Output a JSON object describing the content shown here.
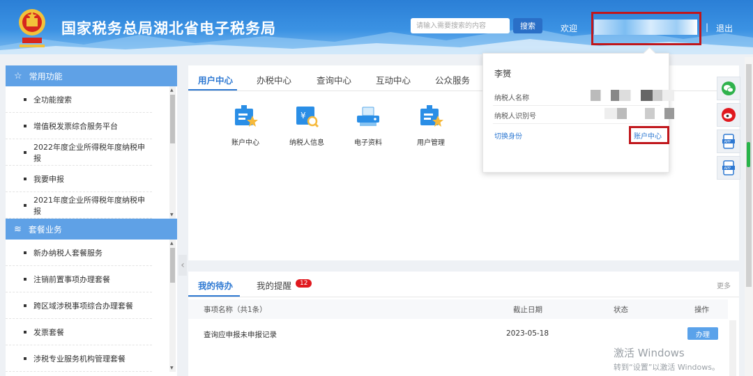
{
  "header": {
    "title": "国家税务总局湖北省电子税务局",
    "search_placeholder": "请输入需要搜索的内容",
    "search_button": "搜索",
    "welcome": "欢迎",
    "separator": "|",
    "logout": "退出"
  },
  "sidebar": {
    "sections": [
      {
        "title": "常用功能",
        "icon": "star-icon",
        "items": [
          "全功能搜索",
          "增值税发票综合服务平台",
          "2022年度企业所得税年度纳税申报",
          "我要申报",
          "2021年度企业所得税年度纳税申报"
        ]
      },
      {
        "title": "套餐业务",
        "icon": "layers-icon",
        "items": [
          "新办纳税人套餐服务",
          "注销前置事项办理套餐",
          "跨区域涉税事项综合办理套餐",
          "发票套餐",
          "涉税专业服务机构管理套餐"
        ]
      }
    ]
  },
  "main": {
    "tabs": [
      "用户中心",
      "办税中心",
      "查询中心",
      "互动中心",
      "公众服务"
    ],
    "active_tab": "用户中心",
    "tiles": [
      {
        "label": "账户中心",
        "icon": "account-center-icon"
      },
      {
        "label": "纳税人信息",
        "icon": "taxpayer-info-icon"
      },
      {
        "label": "电子资料",
        "icon": "e-document-icon"
      },
      {
        "label": "用户管理",
        "icon": "user-management-icon"
      }
    ]
  },
  "popup": {
    "user_name": "李赟",
    "taxpayer_name_label": "纳税人名称",
    "taxpayer_id_label": "纳税人识别号",
    "switch_identity": "切换身份",
    "account_center": "账户中心"
  },
  "float_icons": [
    "wechat-icon",
    "weibo-icon",
    "app-icon",
    "app-icon"
  ],
  "todo": {
    "tab_active": "我的待办",
    "tab_reminder": "我的提醒",
    "reminder_count": "12",
    "more": "更多",
    "columns": [
      "事项名称（共1条）",
      "截止日期",
      "状态",
      "操作"
    ],
    "rows": [
      {
        "name": "查询应申报未申报记录",
        "deadline": "2023-05-18",
        "status": "",
        "action": "办理"
      }
    ]
  },
  "watermark": {
    "line1": "激活 Windows",
    "line2": "转到“设置”以激活 Windows。"
  },
  "colors": {
    "primary": "#2d78d2",
    "sidebar_header": "#5fa1e6",
    "highlight_box": "#c0161b",
    "badge": "#e0191f"
  }
}
